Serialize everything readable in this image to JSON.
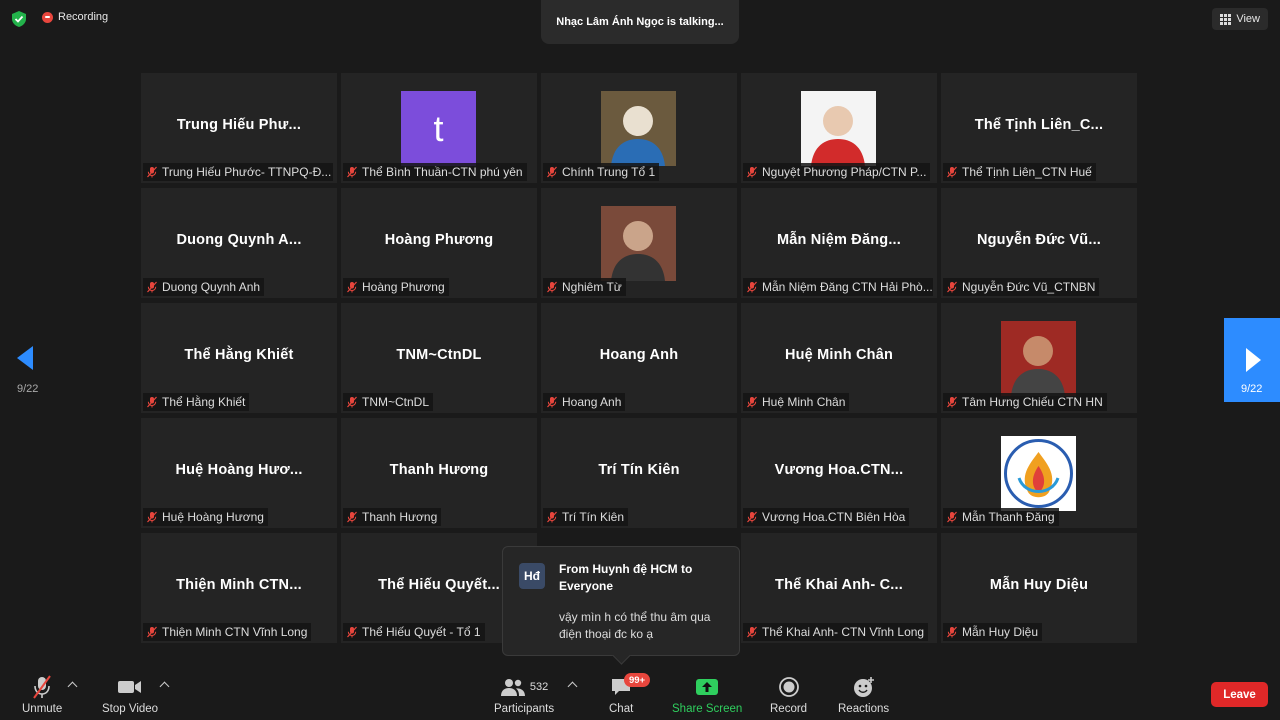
{
  "top": {
    "recording_label": "Recording",
    "talking_label": "Nhạc Lâm Ánh Ngọc is talking...",
    "view_label": "View"
  },
  "tiles": [
    {
      "name": "Trung  Hiếu  Phư...",
      "label": "Trung Hiếu Phước- TTNPQ-Đ...",
      "avatar": null
    },
    {
      "name": "",
      "label": "Thể Bình Thuần-CTN phú yên",
      "avatar": "letter",
      "letter": "t"
    },
    {
      "name": "",
      "label": "Chính Trung Tổ 1",
      "avatar": "photo"
    },
    {
      "name": "",
      "label": "Nguyệt Phương Pháp/CTN P...",
      "avatar": "photo"
    },
    {
      "name": "Thể  Tịnh  Liên_C...",
      "label": "Thể Tịnh Liên_CTN Huế",
      "avatar": null
    },
    {
      "name": "Duong  Quynh  A...",
      "label": "Duong Quynh Anh",
      "avatar": null
    },
    {
      "name": "Hoàng Phương",
      "label": "Hoàng Phương",
      "avatar": null
    },
    {
      "name": "",
      "label": "Nghiêm Từ",
      "avatar": "photo"
    },
    {
      "name": "Mẫn  Niệm  Đăng...",
      "label": "Mẫn Niệm Đăng CTN Hải Phò...",
      "avatar": null
    },
    {
      "name": "Nguyễn  Đức  Vũ...",
      "label": "Nguyễn Đức Vũ_CTNBN",
      "avatar": null
    },
    {
      "name": "Thể Hằng Khiết",
      "label": "Thể Hằng Khiết",
      "avatar": null
    },
    {
      "name": "TNM~CtnDL",
      "label": "TNM~CtnDL",
      "avatar": null
    },
    {
      "name": "Hoang Anh",
      "label": "Hoang Anh",
      "avatar": null
    },
    {
      "name": "Huệ Minh Chân",
      "label": "Huệ Minh Chân",
      "avatar": null
    },
    {
      "name": "",
      "label": "Tâm Hưng Chiếu CTN HN",
      "avatar": "photo"
    },
    {
      "name": "Huệ  Hoàng  Hươ...",
      "label": "Huệ Hoàng Hương",
      "avatar": null
    },
    {
      "name": "Thanh Hương",
      "label": "Thanh Hương",
      "avatar": null
    },
    {
      "name": "Trí Tín Kiên",
      "label": "Trí Tín Kiên",
      "avatar": null
    },
    {
      "name": "Vương  Hoa.CTN...",
      "label": "Vương Hoa.CTN Biên Hòa",
      "avatar": null
    },
    {
      "name": "",
      "label": "Mẫn Thanh Đăng",
      "avatar": "logo"
    },
    {
      "name": "Thiện  Minh  CTN...",
      "label": "Thiện Minh CTN Vĩnh Long",
      "avatar": null
    },
    {
      "name": "Thể  Hiếu  Quyết...",
      "label": "Thể Hiếu Quyết - Tổ 1",
      "avatar": null
    },
    {
      "name": "",
      "label": "",
      "avatar": null
    },
    {
      "name": "Thể  Khai  Anh-  C...",
      "label": "Thể Khai Anh- CTN Vĩnh Long",
      "avatar": null
    },
    {
      "name": "Mẫn Huy Diệu",
      "label": "Mẫn Huy Diệu",
      "avatar": null
    }
  ],
  "pagination": {
    "left": "9/22",
    "right": "9/22"
  },
  "chat_toast": {
    "avatar_initials": "Hđ",
    "from": "From Huynh đệ HCM to Everyone",
    "message": "vậy mìn h có thể thu âm qua điện thoại đc ko ạ"
  },
  "toolbar": {
    "unmute": "Unmute",
    "stop_video": "Stop Video",
    "participants": "Participants",
    "participants_count": "532",
    "chat": "Chat",
    "chat_badge": "99+",
    "share_screen": "Share Screen",
    "record": "Record",
    "reactions": "Reactions",
    "leave": "Leave"
  },
  "colors": {
    "accent": "#2d8cff",
    "leave": "#e02828",
    "share": "#2fcf5e",
    "badge": "#e8463d"
  }
}
